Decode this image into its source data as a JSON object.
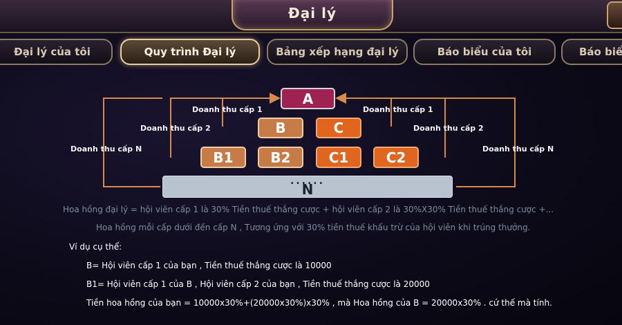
{
  "header": {
    "title": "Đại lý"
  },
  "tabs": [
    {
      "label": "Đại lý của tôi"
    },
    {
      "label": "Quy trình Đại lý",
      "active": true
    },
    {
      "label": "Bảng xếp hạng đại lý"
    },
    {
      "label": "Báo biểu của tôi"
    },
    {
      "label": "Báo biể"
    }
  ],
  "diagram": {
    "nodes": {
      "a": "A",
      "b": "B",
      "c": "C",
      "b1": "B1",
      "b2": "B2",
      "c1": "C1",
      "c2": "C2",
      "n": "N",
      "n_dots": "......"
    },
    "labels": {
      "left_level1": "Doanh thu cấp 1",
      "left_level2": "Doanh thu cấp 2",
      "left_levelN": "Doanh thu cấp N",
      "right_level1": "Doanh thu cấp 1",
      "right_level2": "Doanh thu cấp 2",
      "right_levelN": "Doanh thu cấp N"
    }
  },
  "description": {
    "line1": "Hoa hồng đại lý = hội viên cấp 1 là 30% Tiền thuế thắng cược + hội viên cấp 2 là  30%X30% Tiền thuế thắng cược +...",
    "line2": "Hoa hồng mỗi cấp dưới đến cấp N , Tương ứng với 30% tiền thuế khấu trừ của hội viên khi trúng thưởng."
  },
  "example": {
    "heading": "Ví dụ cụ thể:",
    "line1": "B= Hội viên cấp 1 của bạn , Tiền thuế thắng cược là 10000",
    "line2": "B1= Hội viên cấp 1 của B , Hội viên cấp 2 của bạn , Tiền thuế thắng cược là 20000",
    "line3": "Tiền hoa hồng của bạn = 10000x30%+(20000x30%)x30% ,  mà Hoa hồng của B = 20000x30% . cứ thế mà tính."
  },
  "colors": {
    "arrow": "#d98a4a",
    "node_a": "#9e2352",
    "node_b": "#c77b46",
    "node_c": "#e0651e",
    "node_n": "#b9c3cf"
  }
}
